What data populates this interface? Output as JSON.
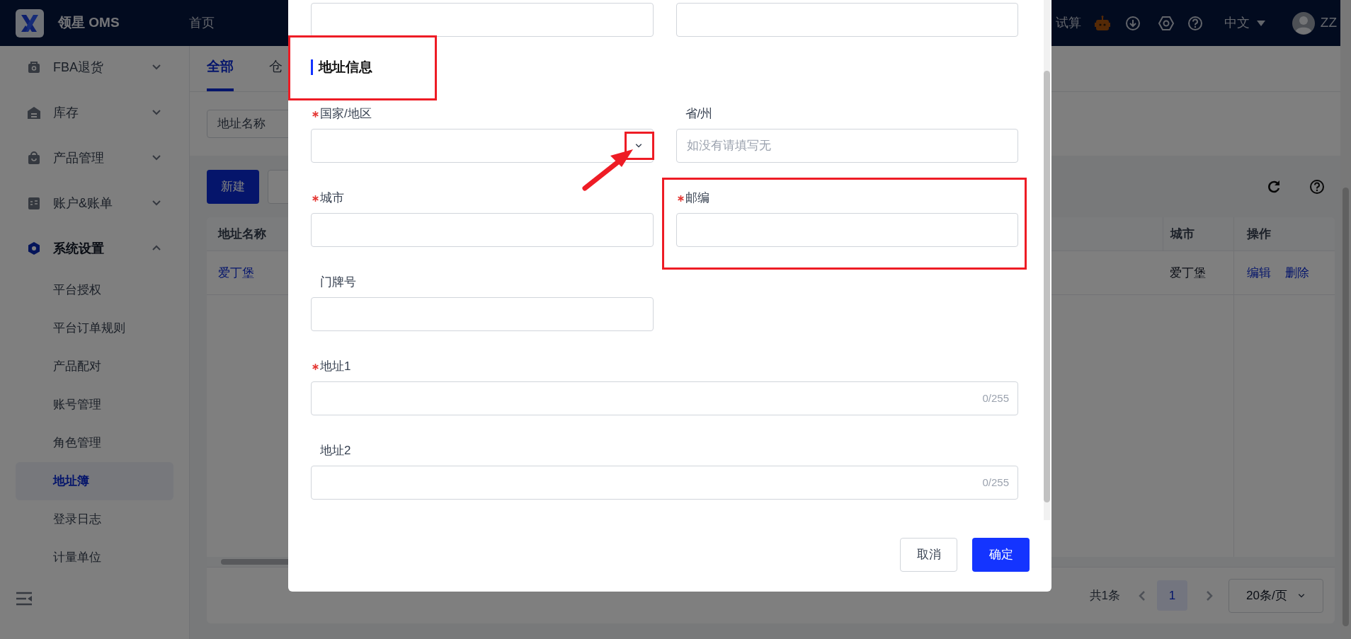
{
  "top_bar": {
    "logo_text": "领星 OMS",
    "nav": [
      {
        "label": "首页"
      }
    ],
    "right_text": "试算",
    "language": "中文",
    "user": "ZZ"
  },
  "sidebar": {
    "items": [
      {
        "label": "FBA退货",
        "expanded": false
      },
      {
        "label": "库存",
        "expanded": false
      },
      {
        "label": "产品管理",
        "expanded": false
      },
      {
        "label": "账户&账单",
        "expanded": false
      },
      {
        "label": "系统设置",
        "expanded": true,
        "children": [
          {
            "label": "平台授权",
            "selected": false
          },
          {
            "label": "平台订单规则",
            "selected": false
          },
          {
            "label": "产品配对",
            "selected": false
          },
          {
            "label": "账号管理",
            "selected": false
          },
          {
            "label": "角色管理",
            "selected": false
          },
          {
            "label": "地址簿",
            "selected": true
          },
          {
            "label": "登录日志",
            "selected": false
          },
          {
            "label": "计量单位",
            "selected": false
          }
        ]
      }
    ]
  },
  "tabs": [
    {
      "label": "全部",
      "selected": true
    },
    {
      "label": "仓",
      "selected": false
    }
  ],
  "filter": {
    "placeholder": "地址名称"
  },
  "toolbar": {
    "buttons": [
      {
        "label": "新建",
        "kind": "primary"
      }
    ]
  },
  "table": {
    "columns": [
      "地址名称",
      "城市",
      "操作"
    ],
    "rows": [
      {
        "name": "爱丁堡",
        "city": "爱丁堡",
        "actions": [
          "编辑",
          "删除"
        ]
      }
    ]
  },
  "pagination": {
    "total": "共1条",
    "pages": [
      {
        "label": "1",
        "selected": true
      }
    ],
    "page_size": "20条/页"
  },
  "dialog": {
    "top_fields": [
      {
        "kind": "input"
      },
      {
        "kind": "input"
      }
    ],
    "section_title": "地址信息",
    "section_highlighted": true,
    "fields": [
      {
        "label": "国家/地区",
        "required": true,
        "kind": "select",
        "highlighted": false,
        "pointed": true
      },
      {
        "label": "省/州",
        "required": false,
        "kind": "input",
        "placeholder": "如没有请填写无",
        "highlighted": false
      },
      {
        "label": "城市",
        "required": true,
        "kind": "input",
        "highlighted": false
      },
      {
        "label": "邮编",
        "required": true,
        "kind": "input",
        "highlighted": true
      },
      {
        "label": "门牌号",
        "required": false,
        "kind": "input",
        "highlighted": false
      },
      {
        "label": "地址1",
        "required": true,
        "kind": "textline",
        "counter": "0/255",
        "highlighted": false
      },
      {
        "label": "地址2",
        "required": false,
        "kind": "textline",
        "counter": "0/255",
        "highlighted": false
      }
    ],
    "buttons": [
      {
        "label": "取消",
        "kind": "secondary"
      },
      {
        "label": "确定",
        "kind": "primary"
      }
    ]
  }
}
